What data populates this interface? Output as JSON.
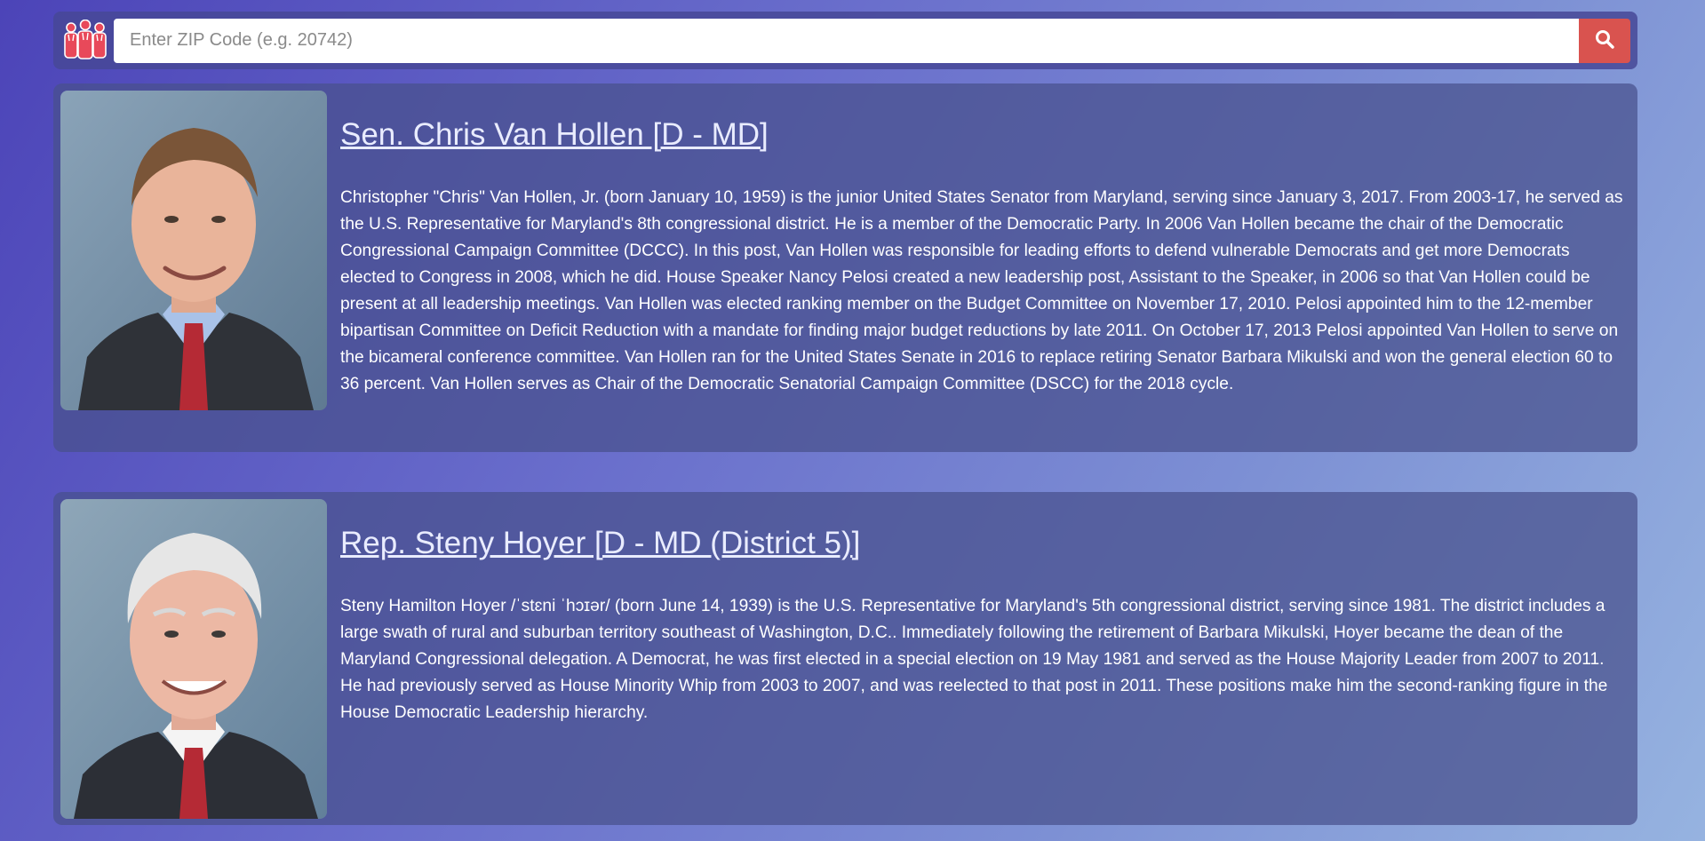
{
  "search": {
    "placeholder": "Enter ZIP Code (e.g. 20742)",
    "value": ""
  },
  "icons": {
    "logo": "people-group-icon",
    "search": "search-icon"
  },
  "colors": {
    "search_button": "#d9534f",
    "logo": "#e8495a"
  },
  "representatives": [
    {
      "name": "Sen. Chris Van Hollen [D - MD]",
      "bio": "Christopher \"Chris\" Van Hollen, Jr. (born January 10, 1959) is the junior United States Senator from Maryland, serving since January 3, 2017. From 2003-17, he served as the U.S. Representative for Maryland's 8th congressional district. He is a member of the Democratic Party. In 2006 Van Hollen became the chair of the Democratic Congressional Campaign Committee (DCCC). In this post, Van Hollen was responsible for leading efforts to defend vulnerable Democrats and get more Democrats elected to Congress in 2008, which he did. House Speaker Nancy Pelosi created a new leadership post, Assistant to the Speaker, in 2006 so that Van Hollen could be present at all leadership meetings. Van Hollen was elected ranking member on the Budget Committee on November 17, 2010. Pelosi appointed him to the 12-member bipartisan Committee on Deficit Reduction with a mandate for finding major budget reductions by late 2011. On October 17, 2013 Pelosi appointed Van Hollen to serve on the bicameral conference committee. Van Hollen ran for the United States Senate in 2016 to replace retiring Senator Barbara Mikulski and won the general election 60 to 36 percent. Van Hollen serves as Chair of the Democratic Senatorial Campaign Committee (DSCC) for the 2018 cycle."
    },
    {
      "name": "Rep. Steny Hoyer [D - MD (District 5)]",
      "bio": "Steny Hamilton Hoyer /ˈstɛni ˈhɔɪər/ (born June 14, 1939) is the U.S. Representative for Maryland's 5th congressional district, serving since 1981. The district includes a large swath of rural and suburban territory southeast of Washington, D.C.. Immediately following the retirement of Barbara Mikulski, Hoyer became the dean of the Maryland Congressional delegation. A Democrat, he was first elected in a special election on 19 May 1981 and served as the House Majority Leader from 2007 to 2011. He had previously served as House Minority Whip from 2003 to 2007, and was reelected to that post in 2011. These positions make him the second-ranking figure in the House Democratic Leadership hierarchy."
    }
  ]
}
